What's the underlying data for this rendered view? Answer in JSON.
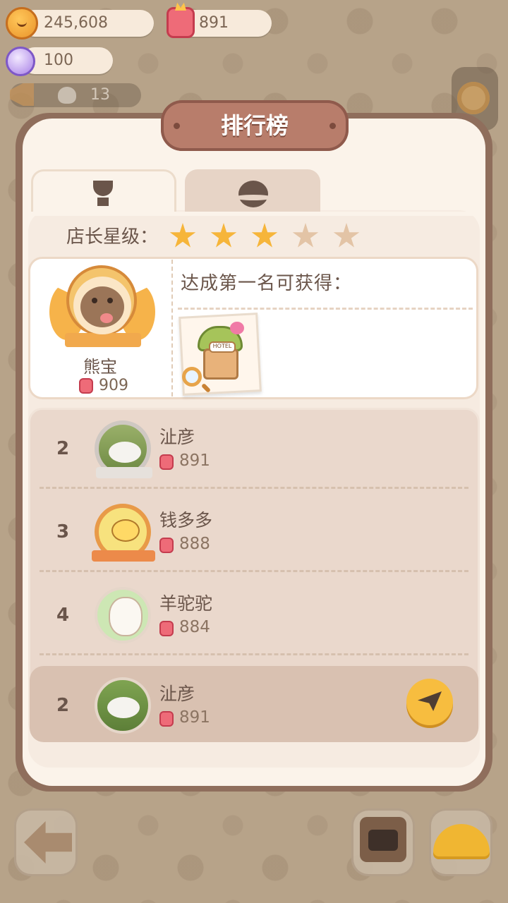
{
  "resources": {
    "coins": "245,608",
    "gems": "891",
    "crystals": "100",
    "notice_count": "13"
  },
  "leaderboard": {
    "title": "排行榜",
    "star_label": "店长星级：",
    "stars": {
      "filled": 3,
      "total": 5
    },
    "tabs": [
      {
        "icon": "trophy-icon",
        "active": true
      },
      {
        "icon": "planet-icon",
        "active": false
      }
    ],
    "first_place": {
      "name": "熊宝",
      "score": "909",
      "reward_label": "达成第一名可获得：",
      "reward_sign": "HOTEL"
    },
    "rows": [
      {
        "rank": "2",
        "name": "沚彦",
        "score": "891"
      },
      {
        "rank": "3",
        "name": "钱多多",
        "score": "888"
      },
      {
        "rank": "4",
        "name": "羊驼驼",
        "score": "884"
      }
    ],
    "self_row": {
      "rank": "2",
      "name": "沚彦",
      "score": "891"
    }
  },
  "colors": {
    "panel_border": "#8f6e5c",
    "title_plate": "#b87d6b",
    "star_on": "#f6b53a",
    "star_off": "#e3c4a6",
    "gem": "#ee6b78",
    "share_button": "#f7bd3f"
  }
}
